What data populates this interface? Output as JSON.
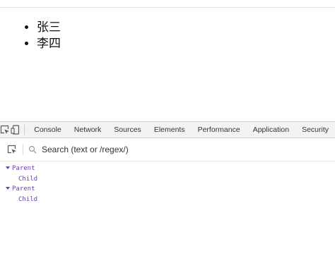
{
  "page": {
    "list_items": [
      "张三",
      "李四"
    ]
  },
  "devtools": {
    "toolbar_icons": [
      "inspect-element-icon",
      "device-toolbar-icon"
    ],
    "tabs": [
      "Console",
      "Network",
      "Sources",
      "Elements",
      "Performance",
      "Application",
      "Security"
    ],
    "search": {
      "tool_icon": "inspect-element-icon",
      "search_icon": "search-icon",
      "placeholder": "Search (text or /regex/)"
    },
    "tree": [
      {
        "label": "Parent",
        "children": [
          "Child"
        ]
      },
      {
        "label": "Parent",
        "children": [
          "Child"
        ]
      }
    ]
  },
  "colors": {
    "tree_text": "#6c3fb5",
    "tabbar_bg": "#f3f3f3",
    "border": "#cfcfcf"
  }
}
